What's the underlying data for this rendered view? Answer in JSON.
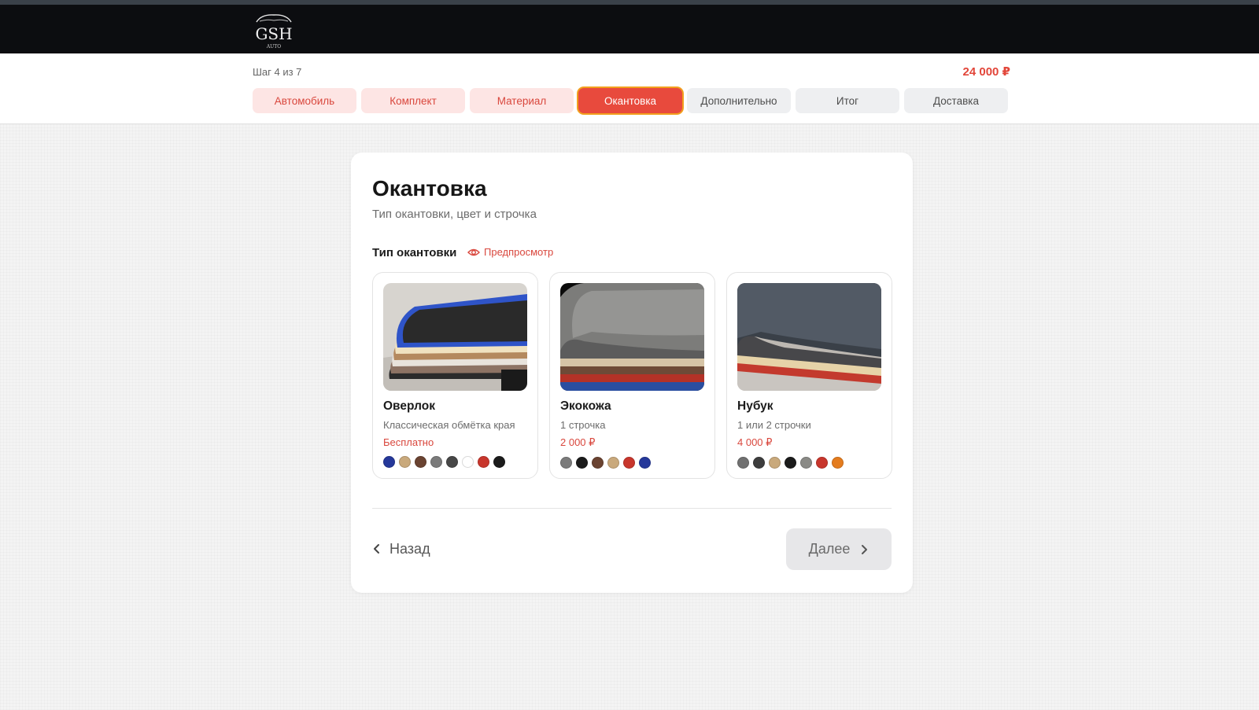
{
  "brand": {
    "logo_text": "GSH",
    "logo_subtext": "AUTO"
  },
  "stepper": {
    "counter": "Шаг 4 из 7",
    "total_price": "24 000 ₽",
    "tabs": [
      {
        "label": "Автомобиль",
        "state": "done"
      },
      {
        "label": "Комплект",
        "state": "done"
      },
      {
        "label": "Материал",
        "state": "done"
      },
      {
        "label": "Окантовка",
        "state": "active"
      },
      {
        "label": "Дополнительно",
        "state": "todo"
      },
      {
        "label": "Итог",
        "state": "todo"
      },
      {
        "label": "Доставка",
        "state": "todo"
      }
    ]
  },
  "page": {
    "title": "Окантовка",
    "subtitle": "Тип окантовки, цвет и строчка",
    "section_label": "Тип окантовки",
    "preview_label": "Предпросмотр"
  },
  "options": [
    {
      "name": "Оверлок",
      "description": "Классическая обмётка края",
      "price": "Бесплатно",
      "colors": [
        "#25389a",
        "#c9a97c",
        "#6a4331",
        "#7b7b7b",
        "#474747",
        "#ffffff",
        "#c8362c",
        "#1b1b1b"
      ]
    },
    {
      "name": "Экокожа",
      "description": "1 строчка",
      "price": "2 000 ₽",
      "colors": [
        "#7b7b7b",
        "#1b1b1b",
        "#6a4331",
        "#c9a97c",
        "#c8362c",
        "#25389a"
      ]
    },
    {
      "name": "Нубук",
      "description": "1 или 2 строчки",
      "price": "4 000 ₽",
      "colors": [
        "#707070",
        "#3d3d3d",
        "#c9a97c",
        "#1b1b1b",
        "#8a8a86",
        "#c8362c",
        "#e47c1e"
      ]
    }
  ],
  "navigation": {
    "back_label": "Назад",
    "next_label": "Далее"
  },
  "colors": {
    "accent": "#e84a3d",
    "active_outline": "#f2a01e",
    "header_bg": "#0c0d10"
  },
  "icons": {
    "preview": "eye-icon",
    "back": "chevron-left-icon",
    "next": "chevron-right-icon"
  }
}
